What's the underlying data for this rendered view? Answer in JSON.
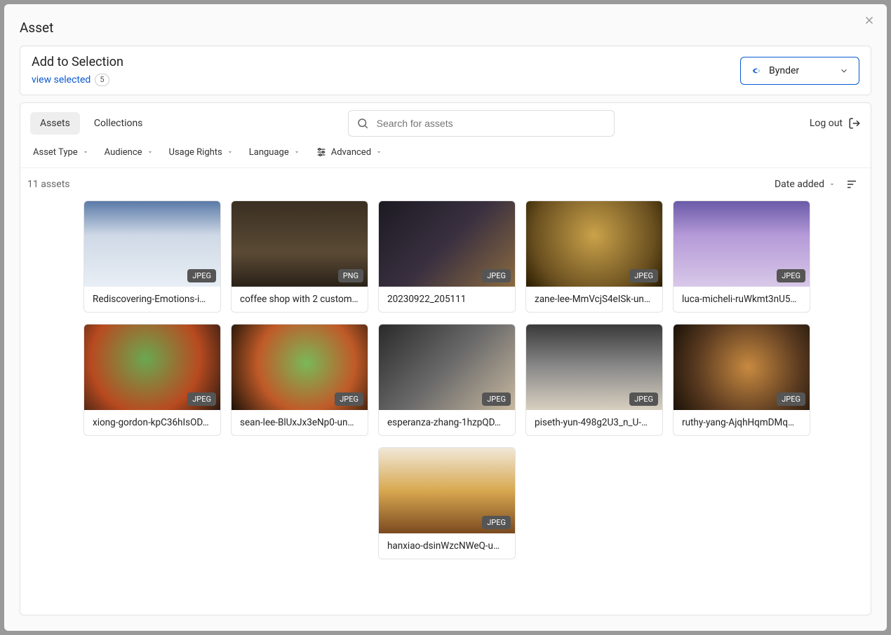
{
  "modal": {
    "title": "Asset"
  },
  "selection": {
    "title": "Add to Selection",
    "view_label": "view selected",
    "count": "5"
  },
  "source": {
    "name": "Bynder"
  },
  "tabs": {
    "assets": "Assets",
    "collections": "Collections"
  },
  "search": {
    "placeholder": "Search for assets"
  },
  "logout": {
    "label": "Log out"
  },
  "filters": {
    "asset_type": "Asset Type",
    "audience": "Audience",
    "usage_rights": "Usage Rights",
    "language": "Language",
    "advanced": "Advanced"
  },
  "results": {
    "count_text": "11 assets",
    "sort_label": "Date added"
  },
  "assets": [
    {
      "title": "Rediscovering-Emotions-i…",
      "format": "JPEG"
    },
    {
      "title": "coffee shop with 2 custom…",
      "format": "PNG"
    },
    {
      "title": "20230922_205111",
      "format": "JPEG"
    },
    {
      "title": "zane-lee-MmVcjS4eISk-un…",
      "format": "JPEG"
    },
    {
      "title": "luca-micheli-ruWkmt3nU5…",
      "format": "JPEG"
    },
    {
      "title": "xiong-gordon-kpC36hIsOD…",
      "format": "JPEG"
    },
    {
      "title": "sean-lee-BlUxJx3eNp0-un…",
      "format": "JPEG"
    },
    {
      "title": "esperanza-zhang-1hzpQD…",
      "format": "JPEG"
    },
    {
      "title": "piseth-yun-498g2U3_n_U-…",
      "format": "JPEG"
    },
    {
      "title": "ruthy-yang-AjqhHqmDMq…",
      "format": "JPEG"
    },
    {
      "title": "hanxiao-dsinWzcNWeQ-u…",
      "format": "JPEG"
    }
  ]
}
